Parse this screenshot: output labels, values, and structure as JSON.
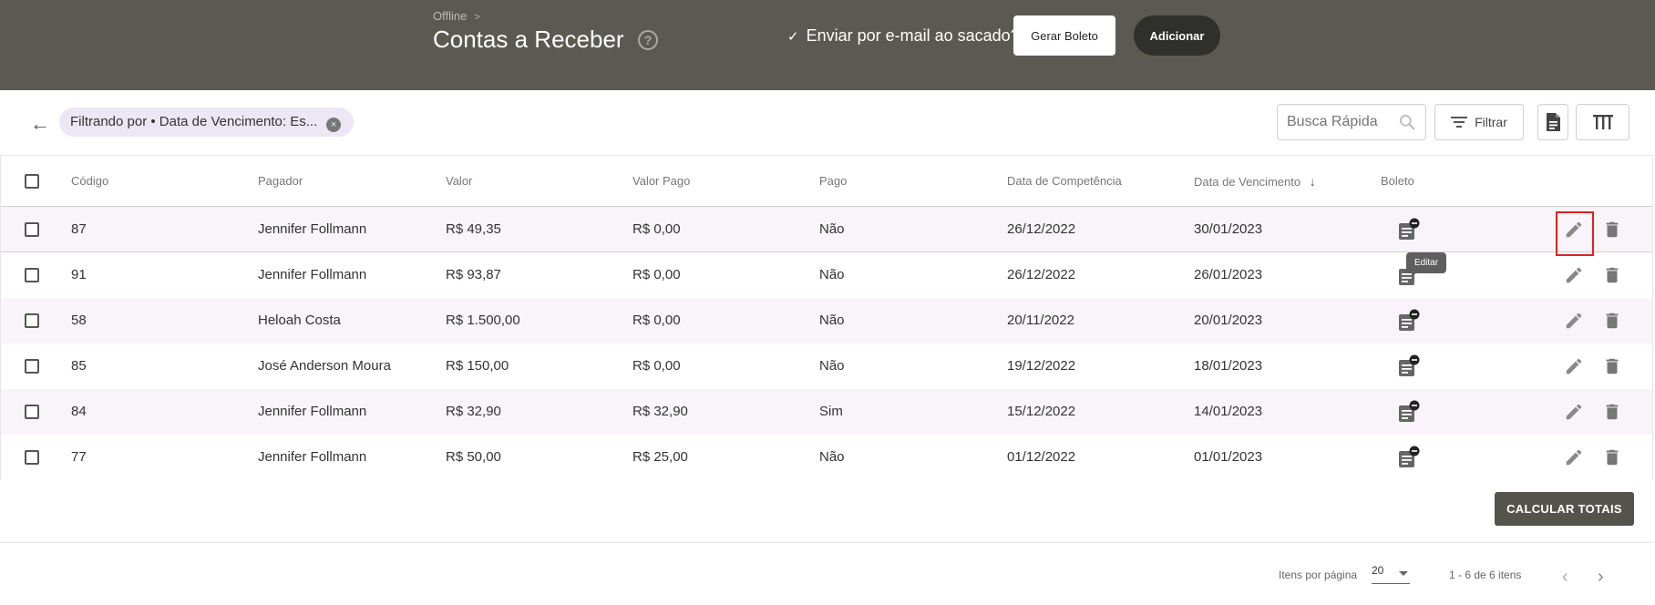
{
  "header": {
    "breadcrumb": "Offline",
    "breadcrumb_sep": ">",
    "title": "Contas a Receber",
    "help_icon": "?",
    "email_check_mark": "✓",
    "email_label": "Enviar por e-mail ao sacado?",
    "gerar_boleto_label": "Gerar Boleto",
    "adicionar_label": "Adicionar"
  },
  "filters": {
    "back_icon": "←",
    "chip_label": "Filtrando por • Data de Vencimento: Es...",
    "chip_remove_icon": "×",
    "search_placeholder": "Busca Rápida",
    "filter_label": "Filtrar"
  },
  "table": {
    "columns": [
      "Código",
      "Pagador",
      "Valor",
      "Valor Pago",
      "Pago",
      "Data de Competência",
      "Data de Vencimento",
      "Boleto"
    ],
    "sort_icon": "↓",
    "rows": [
      {
        "codigo": "87",
        "pagador": "Jennifer Follmann",
        "valor": "R$ 49,35",
        "valor_pago": "R$ 0,00",
        "pago": "Não",
        "competencia": "26/12/2022",
        "vencimento": "30/01/2023"
      },
      {
        "codigo": "91",
        "pagador": "Jennifer Follmann",
        "valor": "R$ 93,87",
        "valor_pago": "R$ 0,00",
        "pago": "Não",
        "competencia": "26/12/2022",
        "vencimento": "26/01/2023"
      },
      {
        "codigo": "58",
        "pagador": "Heloah Costa",
        "valor": "R$ 1.500,00",
        "valor_pago": "R$ 0,00",
        "pago": "Não",
        "competencia": "20/11/2022",
        "vencimento": "20/01/2023"
      },
      {
        "codigo": "85",
        "pagador": "José Anderson Moura",
        "valor": "R$ 150,00",
        "valor_pago": "R$ 0,00",
        "pago": "Não",
        "competencia": "19/12/2022",
        "vencimento": "18/01/2023"
      },
      {
        "codigo": "84",
        "pagador": "Jennifer Follmann",
        "valor": "R$ 32,90",
        "valor_pago": "R$ 32,90",
        "pago": "Sim",
        "competencia": "15/12/2022",
        "vencimento": "14/01/2023"
      },
      {
        "codigo": "77",
        "pagador": "Jennifer Follmann",
        "valor": "R$ 50,00",
        "valor_pago": "R$ 25,00",
        "pago": "Não",
        "competencia": "01/12/2022",
        "vencimento": "01/01/2023"
      }
    ],
    "tooltip": "Editar"
  },
  "footer": {
    "calc_label": "CALCULAR TOTAIS",
    "per_page_label": "Itens por página",
    "per_page_value": "20",
    "range": "1 - 6 de 6 itens",
    "prev_icon": "‹",
    "next_icon": "›"
  },
  "colors": {
    "header_bg": "#5b5a52",
    "accent_dark": "#2f2f2b",
    "row_alt": "#f8f4f9",
    "highlight": "#e02020"
  }
}
